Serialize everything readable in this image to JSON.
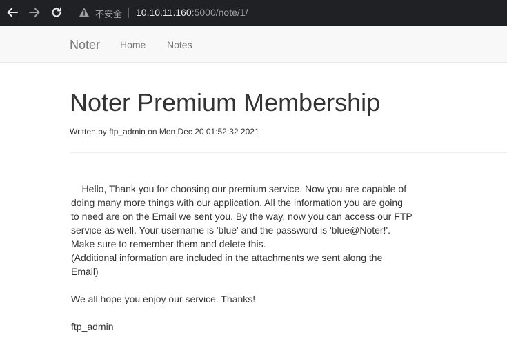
{
  "browser": {
    "security_label": "不安全",
    "url_host": "10.10.11.160",
    "url_rest": ":5000/note/1/"
  },
  "navbar": {
    "brand": "Noter",
    "links": [
      "Home",
      "Notes"
    ]
  },
  "note": {
    "title": "Noter Premium Membership",
    "meta": "Written by ftp_admin on Mon Dec 20 01:52:32 2021",
    "lines": [
      "    Hello, Thank you for choosing our premium service. Now you are capable of",
      "doing many more things with our application. All the information you are going",
      "to need are on the Email we sent you. By the way, now you can access our FTP",
      "service as well. Your username is 'blue' and the password is 'blue@Noter!'.",
      "Make sure to remember them and delete this.",
      "(Additional information are included in the attachments we sent along the",
      "Email)",
      "We all hope you enjoy our service. Thanks!",
      "ftp_admin"
    ]
  }
}
